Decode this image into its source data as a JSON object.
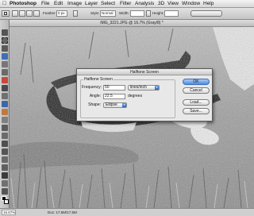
{
  "menubar": {
    "app_name": "Photoshop",
    "items": [
      "File",
      "Edit",
      "Image",
      "Layer",
      "Select",
      "Filter",
      "Analysis",
      "3D",
      "View",
      "Window",
      "Help"
    ]
  },
  "options_bar": {
    "feather_label": "Feather:",
    "feather_value": "0 px",
    "style_label": "Style:",
    "style_value": "Normal",
    "width_label": "Width:",
    "height_label": "Height:"
  },
  "document": {
    "title": "IMG_3221.JPG @ 16.7% (Gray/8) *"
  },
  "status": {
    "zoom": "16.67%",
    "doc_info": "Doc: 17.5M/17.5M"
  },
  "dialog": {
    "title": "Halftone Screen",
    "group_label": "Halftone Screen",
    "frequency_label": "Frequency:",
    "frequency_value": "50",
    "frequency_unit": "lines/inch",
    "angle_label": "Angle:",
    "angle_value": "22.5",
    "angle_unit": "degrees",
    "shape_label": "Shape:",
    "shape_value": "Ellipse",
    "ok_label": "OK",
    "cancel_label": "Cancel",
    "load_label": "Load...",
    "save_label": "Save..."
  },
  "colors": {
    "dialog_bg": "#e8e8e8",
    "default_button": "#4f8be1",
    "photo_grass": "#9a9a9a"
  }
}
